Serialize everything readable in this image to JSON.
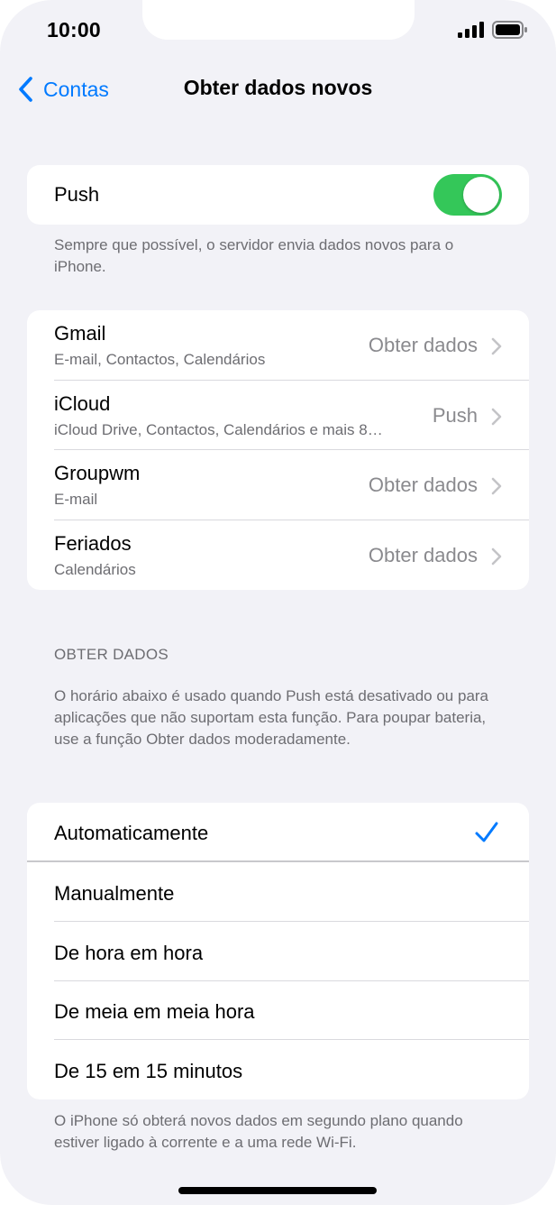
{
  "status_bar": {
    "time": "10:00"
  },
  "nav": {
    "back_label": "Contas",
    "title": "Obter dados novos"
  },
  "push": {
    "label": "Push",
    "enabled": true,
    "footnote": "Sempre que possível, o servidor envia dados novos para o iPhone."
  },
  "accounts": [
    {
      "name": "Gmail",
      "subtitle": "E-mail, Contactos, Calendários",
      "value": "Obter dados"
    },
    {
      "name": "iCloud",
      "subtitle": "iCloud Drive, Contactos, Calendários e mais 8…",
      "value": "Push"
    },
    {
      "name": "Groupwm",
      "subtitle": "E-mail",
      "value": "Obter dados"
    },
    {
      "name": "Feriados",
      "subtitle": "Calendários",
      "value": "Obter dados"
    }
  ],
  "fetch": {
    "header": "OBTER DADOS",
    "description": "O horário abaixo é usado quando Push está desativado ou para aplicações que não suportam esta função. Para poupar bateria, use a função Obter dados moderadamente.",
    "options": [
      {
        "label": "Automaticamente",
        "selected": true
      },
      {
        "label": "Manualmente",
        "selected": false
      },
      {
        "label": "De hora em hora",
        "selected": false
      },
      {
        "label": "De meia em meia hora",
        "selected": false
      },
      {
        "label": "De 15 em 15 minutos",
        "selected": false
      }
    ],
    "footnote": "O iPhone só obterá novos dados em segundo plano quando estiver ligado à corrente e a uma rede Wi-Fi."
  },
  "colors": {
    "accent": "#007aff",
    "toggle_on": "#34c759",
    "background": "#f2f2f7"
  }
}
